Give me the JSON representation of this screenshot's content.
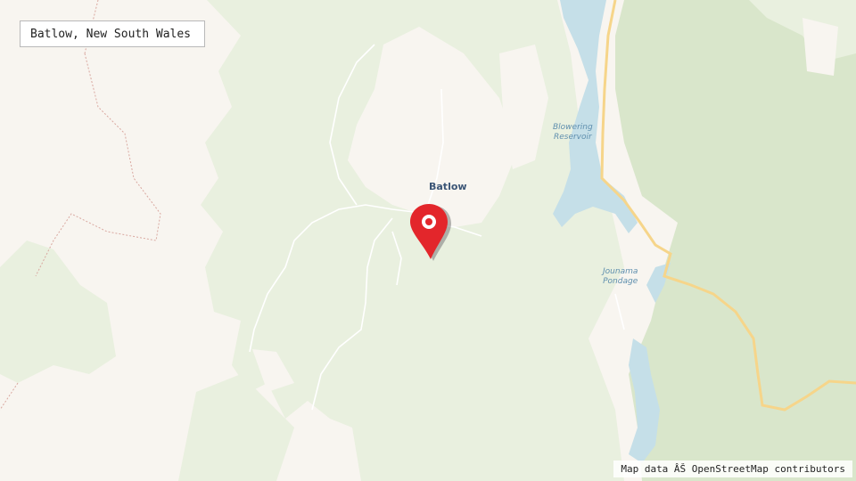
{
  "location_box": {
    "text": "Batlow, New South Wales"
  },
  "map": {
    "place_labels": {
      "town": "Batlow"
    },
    "water_labels": {
      "blowering": [
        "Blowering",
        "Reservoir"
      ],
      "jounama": [
        "Jounama",
        "Pondage"
      ]
    },
    "colors": {
      "land": "#f8f5f0",
      "forest_light": "#e9f0df",
      "forest_dark": "#d9e6cb",
      "water": "#c5dfe8",
      "highway": "#f6d58a",
      "marker": "#e3262b"
    }
  },
  "marker": {
    "icon": "map-pin-icon",
    "label": "Batlow"
  },
  "attribution": {
    "text": "Map data ÂŠ OpenStreetMap contributors"
  }
}
